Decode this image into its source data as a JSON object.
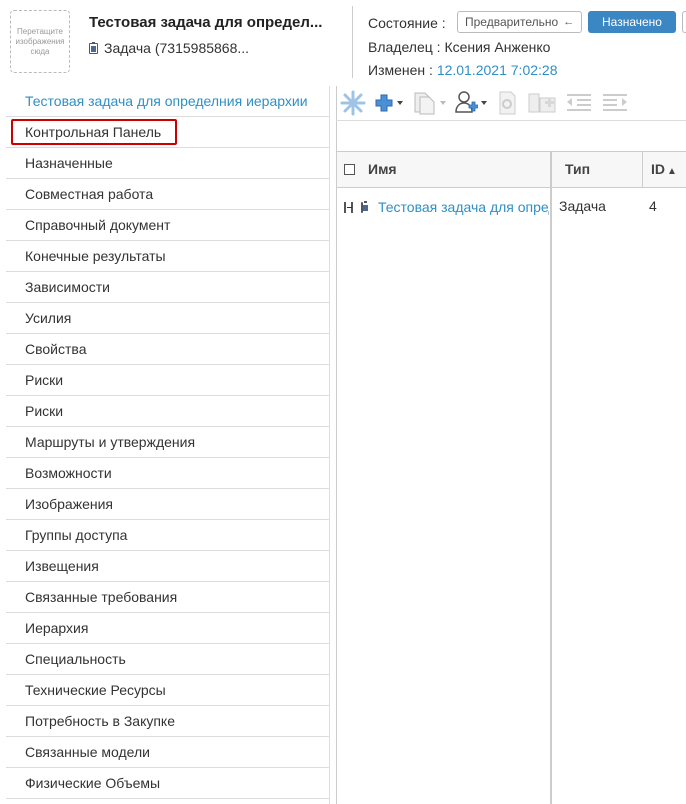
{
  "header": {
    "dropzone_text": "Перетащите изображения сюда",
    "title": "Тестовая задача для определ...",
    "subtitle": "Задача (7315985868...",
    "state_label": "Состояние :",
    "state_value": "Предварительно",
    "state_arrow": "←",
    "assigned_button": "Назначено",
    "owner_label": "Владелец :",
    "owner_value": "Ксения Анженко",
    "modified_label": "Изменен :",
    "modified_value": "12.01.2021 7:02:28"
  },
  "sidebar": {
    "items": [
      {
        "label": "Тестовая задача для определния иерархии"
      },
      {
        "label": "Контрольная Панель"
      },
      {
        "label": "Назначенные"
      },
      {
        "label": "Совместная работа"
      },
      {
        "label": "Справочный документ"
      },
      {
        "label": "Конечные результаты"
      },
      {
        "label": "Зависимости"
      },
      {
        "label": "Усилия"
      },
      {
        "label": "Свойства"
      },
      {
        "label": "Риски"
      },
      {
        "label": "Риски"
      },
      {
        "label": "Маршруты и утверждения"
      },
      {
        "label": "Возможности"
      },
      {
        "label": "Изображения"
      },
      {
        "label": "Группы доступа"
      },
      {
        "label": "Извещения"
      },
      {
        "label": "Связанные требования"
      },
      {
        "label": "Иерархия"
      },
      {
        "label": "Специальность"
      },
      {
        "label": "Технические Ресурсы"
      },
      {
        "label": "Потребность в Закупке"
      },
      {
        "label": "Связанные модели"
      },
      {
        "label": "Физические Объемы"
      }
    ]
  },
  "grid": {
    "columns": {
      "name": "Имя",
      "type": "Тип",
      "id": "ID",
      "id_sort": "▲"
    },
    "rows": [
      {
        "name": "Тестовая задача для определния иерархии",
        "type": "Задача",
        "id": "4"
      }
    ]
  },
  "colors": {
    "accent": "#3b87c4",
    "link": "#2f8fc6",
    "highlight": "#cc0000"
  }
}
